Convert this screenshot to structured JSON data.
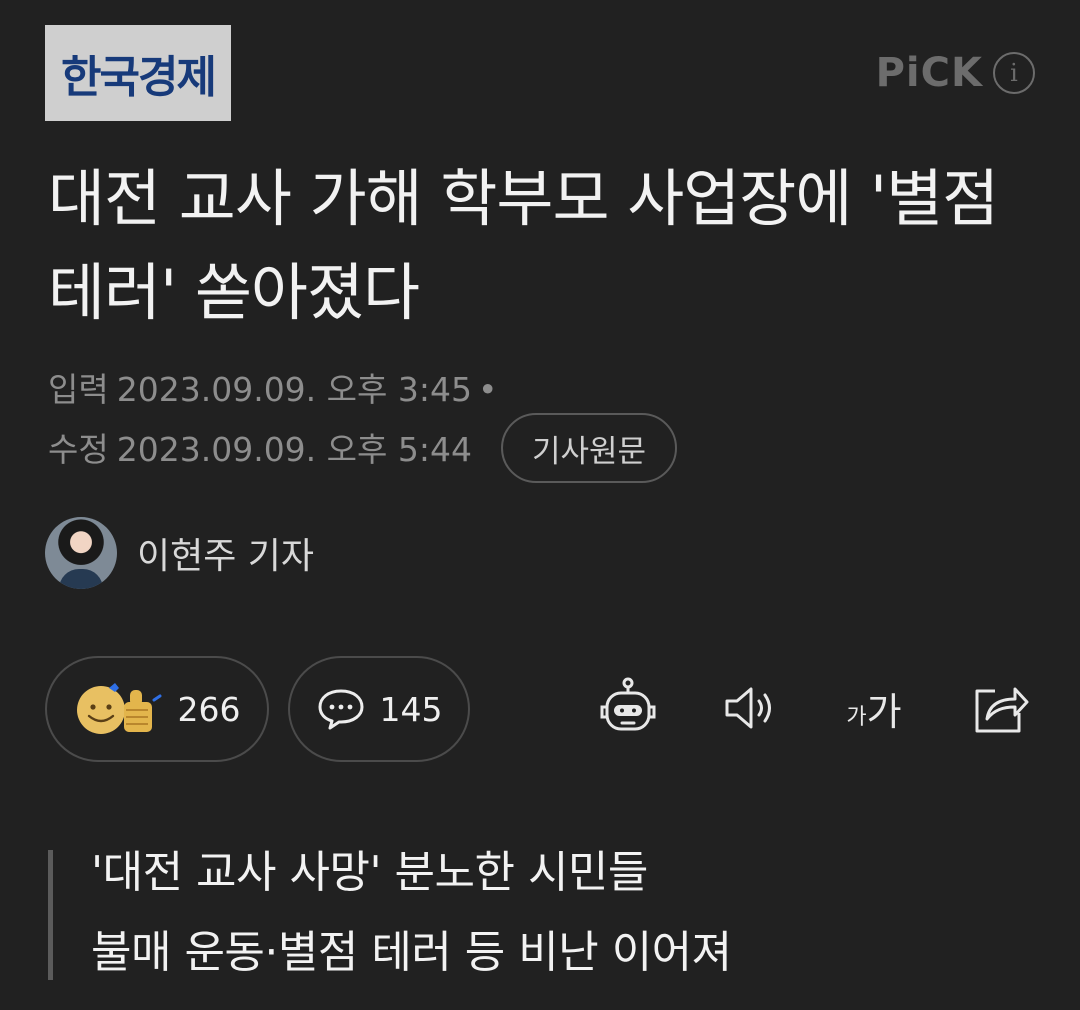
{
  "header": {
    "publisher_logo_text": "한국경제",
    "pick_label": "PiCK",
    "pick_info_glyph": "i"
  },
  "article": {
    "headline": "대전 교사 가해 학부모 사업장에 '별점 테러' 쏟아졌다",
    "input_label": "입력",
    "input_time": "2023.09.09. 오후 3:45",
    "bullet": "•",
    "edit_label": "수정",
    "edit_time": "2023.09.09. 오후 5:44",
    "source_button": "기사원문",
    "reporter_name": "이현주 기자"
  },
  "actions": {
    "reactions_count": "266",
    "comments_count": "145",
    "icons": [
      "robot-summary-icon",
      "speaker-icon",
      "font-size-icon",
      "share-icon"
    ],
    "font_small": "가",
    "font_big": "가"
  },
  "summary": {
    "lines": [
      "'대전 교사 사망' 분노한 시민들",
      "불매 운동·별점 테러 등 비난 이어져"
    ]
  },
  "colors": {
    "background": "#212121",
    "muted_text": "#8d8d8d",
    "border": "#4b4b4b",
    "logo_blue": "#173a7a"
  }
}
